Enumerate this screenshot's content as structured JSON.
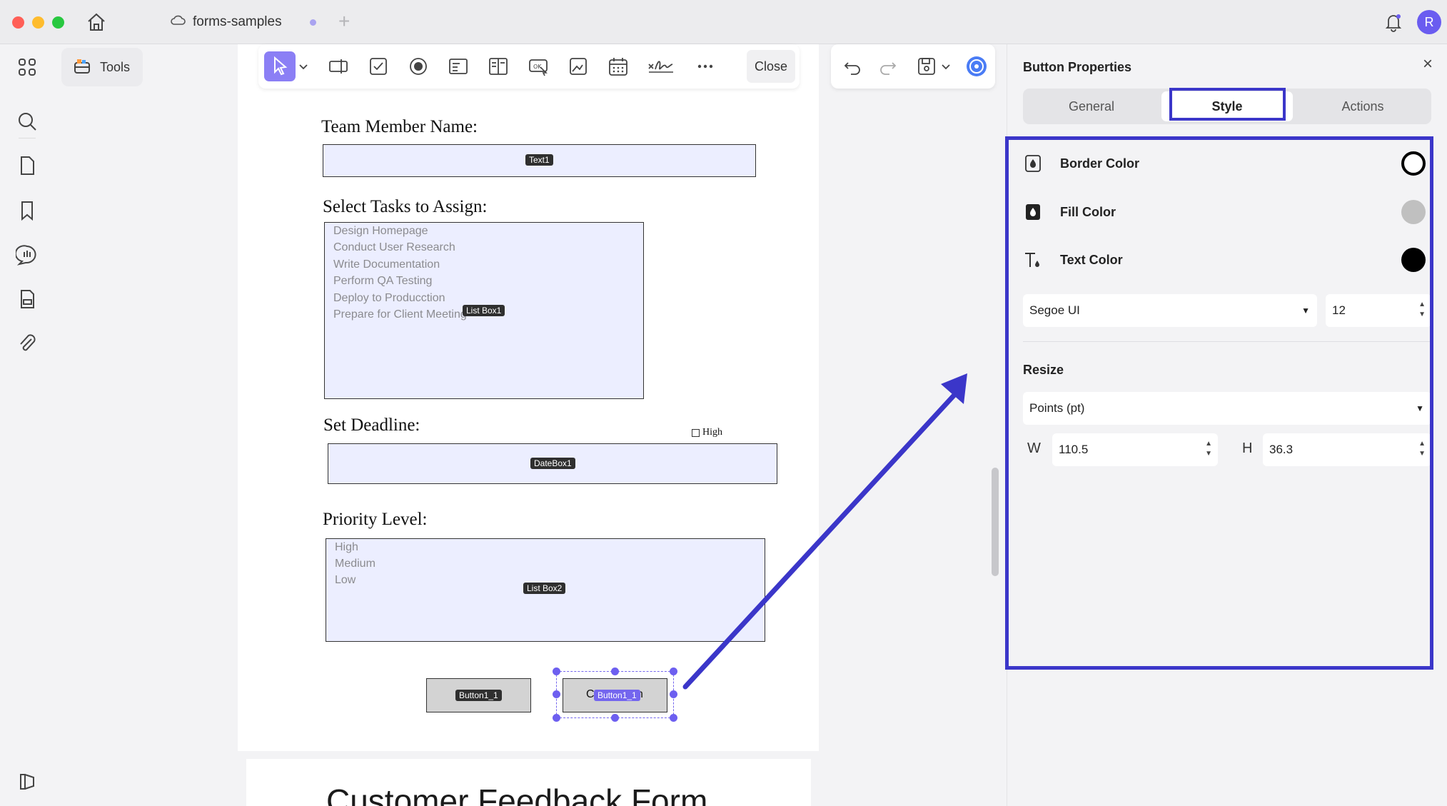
{
  "titlebar": {
    "tab_title": "forms-samples",
    "new_tab": "+",
    "avatar_initial": "R"
  },
  "sidebar": {
    "icons": [
      "grid-icon",
      "search-icon",
      "page-icon",
      "bookmark-icon",
      "comment-icon",
      "form-icon",
      "attachment-icon",
      "panel-toggle-icon"
    ]
  },
  "tools": {
    "label": "Tools"
  },
  "toolbar": {
    "close_label": "Close"
  },
  "document": {
    "labels": {
      "team_member": "Team Member Name:",
      "select_tasks": "Select Tasks to Assign:",
      "set_deadline": "Set Deadline:",
      "priority": "Priority Level:"
    },
    "fields": {
      "text1": "Text1",
      "listbox1": "List Box1",
      "datebox1": "DateBox1",
      "listbox2": "List Box2",
      "button1": "Button1_1",
      "button2": "Button1_1",
      "button2_left_text": "C",
      "button2_right_text": "n"
    },
    "tasks": [
      "Design Homepage",
      "Conduct User Research",
      "Write Documentation",
      "Perform QA Testing",
      "Deploy to Producction",
      "Prepare for Client Meeting"
    ],
    "priorities": [
      "High",
      "Medium",
      "Low"
    ],
    "checkbox_label": "High",
    "next_page_title": "Customer Feedback Form"
  },
  "panel": {
    "title": "Button Properties",
    "tabs": [
      "General",
      "Style",
      "Actions"
    ],
    "active_tab": "Style",
    "border_color_label": "Border Color",
    "fill_color_label": "Fill Color",
    "text_color_label": "Text Color",
    "colors": {
      "border": "#000000",
      "fill": "#c0c0c0",
      "text": "#000000"
    },
    "font": "Segoe UI",
    "font_size": "12",
    "resize_label": "Resize",
    "unit": "Points (pt)",
    "w_label": "W",
    "h_label": "H",
    "width": "110.5",
    "height": "36.3"
  },
  "annotation": {
    "accent": "#3b36c9"
  }
}
